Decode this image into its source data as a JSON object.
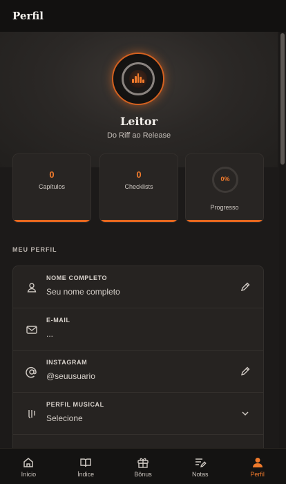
{
  "header": {
    "title": "Perfil"
  },
  "profile": {
    "name": "Leitor",
    "subtitle": "Do Riff ao Release",
    "avatar_icon": "equalizer-icon"
  },
  "stats": [
    {
      "value": "0",
      "label": "Capítulos"
    },
    {
      "value": "0",
      "label": "Checklists"
    },
    {
      "value": "0%",
      "label": "Progresso",
      "progress": 0
    }
  ],
  "section_title": "MEU PERFIL",
  "fields": [
    {
      "label": "NOME COMPLETO",
      "value": "Seu nome completo",
      "icon": "user-icon",
      "action_icon": "pencil-icon"
    },
    {
      "label": "E-MAIL",
      "value": "...",
      "icon": "mail-icon"
    },
    {
      "label": "INSTAGRAM",
      "value": "@seuusuario",
      "icon": "at-icon",
      "action_icon": "pencil-icon"
    },
    {
      "label": "PERFIL MUSICAL",
      "value": "Selecione",
      "icon": "music-icon",
      "action_icon": "chevron-down-icon"
    }
  ],
  "nav": [
    {
      "label": "Início",
      "icon": "home-icon"
    },
    {
      "label": "Índice",
      "icon": "book-icon"
    },
    {
      "label": "Bônus",
      "icon": "gift-icon"
    },
    {
      "label": "Notas",
      "icon": "notes-icon"
    },
    {
      "label": "Perfil",
      "icon": "person-icon",
      "active": true
    }
  ],
  "colors": {
    "accent": "#f07a2c",
    "background": "#1c1a19",
    "card": "#262321"
  }
}
